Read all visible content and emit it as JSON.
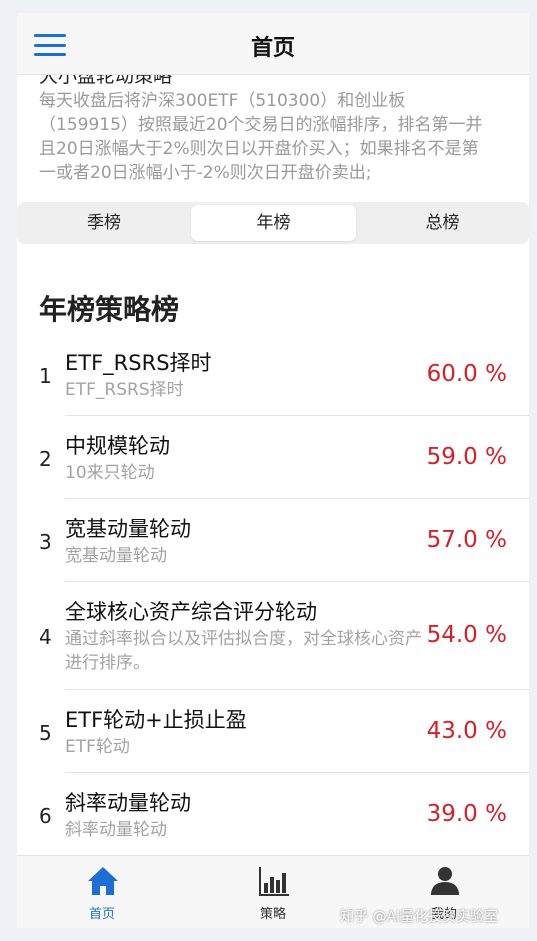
{
  "navbar": {
    "title": "首页",
    "menu_icon": "hamburger-menu-icon"
  },
  "description": {
    "title": "大小盘轮动策略",
    "text": "每天收盘后将沪深300ETF（510300）和创业板（159915）按照最近20个交易日的涨幅排序，排名第一并且20日涨幅大于2%则次日以开盘价买入；如果排名不是第一或者20日涨幅小于-2%则次日开盘价卖出;"
  },
  "segments": [
    {
      "label": "季榜",
      "active": false
    },
    {
      "label": "年榜",
      "active": true
    },
    {
      "label": "总榜",
      "active": false
    }
  ],
  "section_title": "年榜策略榜",
  "rankings": [
    {
      "rank": "1",
      "name": "ETF_RSRS择时",
      "sub": "ETF_RSRS择时",
      "pct": "60.0 %"
    },
    {
      "rank": "2",
      "name": "中规模轮动",
      "sub": "10来只轮动",
      "pct": "59.0 %"
    },
    {
      "rank": "3",
      "name": "宽基动量轮动",
      "sub": "宽基动量轮动",
      "pct": "57.0 %"
    },
    {
      "rank": "4",
      "name": "全球核心资产综合评分轮动",
      "sub": "通过斜率拟合以及评估拟合度，对全球核心资产进行排序。",
      "pct": "54.0 %"
    },
    {
      "rank": "5",
      "name": "ETF轮动+止损止盈",
      "sub": "ETF轮动",
      "pct": "43.0 %"
    },
    {
      "rank": "6",
      "name": "斜率动量轮动",
      "sub": "斜率动量轮动",
      "pct": "39.0 %"
    }
  ],
  "tabbar": [
    {
      "label": "首页",
      "icon": "home-icon",
      "active": true
    },
    {
      "label": "策略",
      "icon": "bar-chart-icon",
      "active": false
    },
    {
      "label": "我的",
      "icon": "user-icon",
      "active": false
    }
  ],
  "watermark": "知乎 @AI量化投资实验室",
  "colors": {
    "accent": "#1d6fd6",
    "percent": "#d5202a"
  }
}
